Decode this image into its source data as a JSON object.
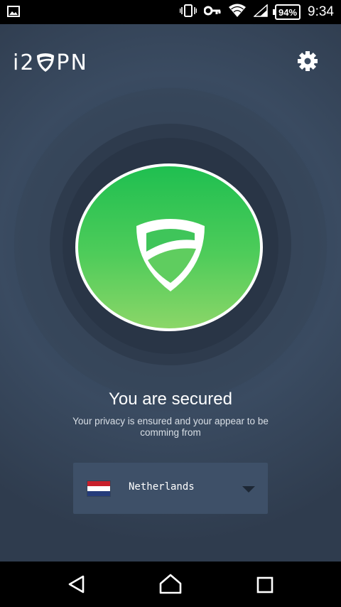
{
  "status_bar": {
    "battery": "94%",
    "time": "9:34"
  },
  "app": {
    "logo": {
      "prefix": "i2",
      "suffix": "PN"
    },
    "status_title": "You are secured",
    "status_message": "Your privacy is ensured and your appear to be comming from",
    "location": {
      "country": "Netherlands",
      "flag_colors": [
        "#c8202c",
        "#ffffff",
        "#243b7a"
      ]
    },
    "connect_button_colors": [
      "#1fbf50",
      "#8bd668"
    ],
    "icons": {
      "settings": "gear-icon",
      "shield": "shield-icon",
      "dropdown": "caret-down-icon"
    }
  },
  "nav_bar": {
    "icons": [
      "back-icon",
      "home-icon",
      "recent-apps-icon"
    ]
  }
}
